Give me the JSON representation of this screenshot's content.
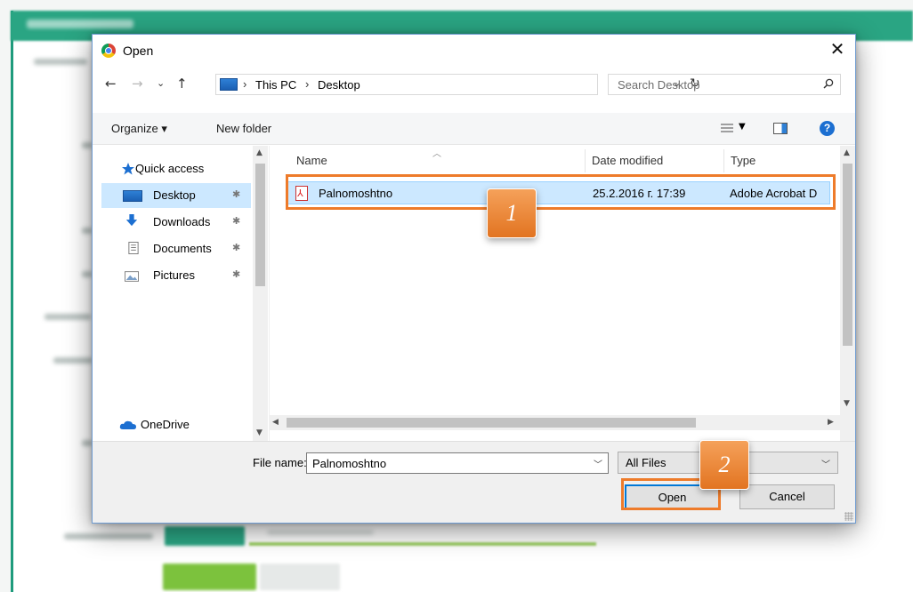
{
  "dialog": {
    "title": "Open",
    "close_glyph": "✕"
  },
  "address": {
    "back_glyph": "←",
    "forward_glyph": "→",
    "recent_glyph": "⌄",
    "up_glyph": "↑",
    "crumbs": [
      "This PC",
      "Desktop"
    ],
    "crumb_sep": "›",
    "dropdown_glyph": "⌄",
    "refresh_glyph": "↻",
    "search_placeholder": "Search Desktop"
  },
  "toolbar": {
    "organize_label": "Organize ▾",
    "new_folder_label": "New folder",
    "help_glyph": "?"
  },
  "nav": {
    "items": [
      {
        "label": "Quick access",
        "icon": "star-icon",
        "color": "#1c6fd1"
      },
      {
        "label": "Desktop",
        "icon": "desktop-icon",
        "color": "#2e80d6"
      },
      {
        "label": "Downloads",
        "icon": "downloads-icon",
        "color": "#1c6fd1"
      },
      {
        "label": "Documents",
        "icon": "documents-icon",
        "color": "#8a8a8a"
      },
      {
        "label": "Pictures",
        "icon": "pictures-icon",
        "color": "#8a8a8a"
      },
      {
        "label": "OneDrive",
        "icon": "onedrive-icon",
        "color": "#1c6fd1"
      }
    ],
    "pin_glyph": "✱"
  },
  "files": {
    "columns": [
      "Name",
      "Date modified",
      "Type"
    ],
    "rows": [
      {
        "name": "Palnomoshtno",
        "date": "25.2.2016 г. 17:39",
        "type": "Adobe Acrobat D"
      }
    ]
  },
  "footer": {
    "file_name_label": "File name:",
    "file_name_value": "Palnomoshtno",
    "file_type_value": "All Files",
    "open_label": "Open",
    "cancel_label": "Cancel"
  },
  "callouts": {
    "step1": "1",
    "step2": "2",
    "highlight_color": "#ee7b2a"
  },
  "colors": {
    "accent": "#2aa583",
    "selection": "#cce8ff",
    "primary_button_border": "#0078d7"
  }
}
